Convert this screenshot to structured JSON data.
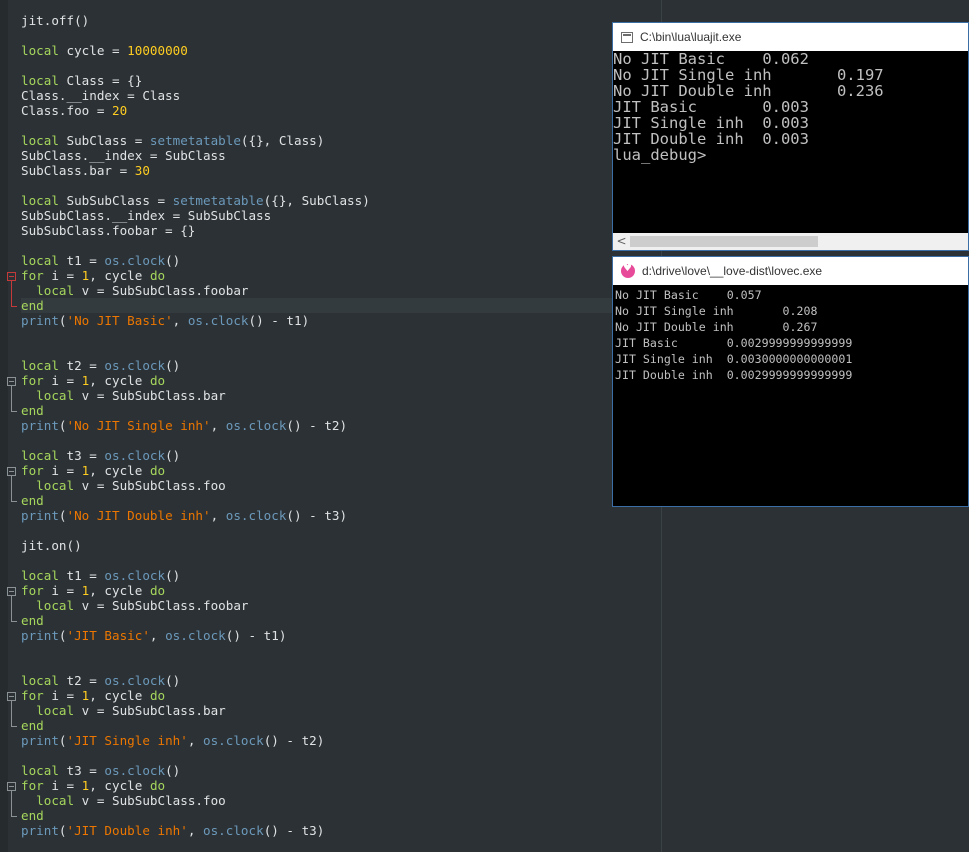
{
  "editor": {
    "lines": [
      [
        [
          "t",
          "jit.off()"
        ]
      ],
      [],
      [
        [
          "kw",
          "local"
        ],
        [
          "t",
          " cycle = "
        ],
        [
          "num",
          "10000000"
        ]
      ],
      [],
      [
        [
          "kw",
          "local"
        ],
        [
          "t",
          " Class = {}"
        ]
      ],
      [
        [
          "t",
          "Class.__index = Class"
        ]
      ],
      [
        [
          "t",
          "Class.foo = "
        ],
        [
          "num",
          "20"
        ]
      ],
      [],
      [
        [
          "kw",
          "local"
        ],
        [
          "t",
          " SubClass = "
        ],
        [
          "fn",
          "setmetatable"
        ],
        [
          "t",
          "({}, Class)"
        ]
      ],
      [
        [
          "t",
          "SubClass.__index = SubClass"
        ]
      ],
      [
        [
          "t",
          "SubClass.bar = "
        ],
        [
          "num",
          "30"
        ]
      ],
      [],
      [
        [
          "kw",
          "local"
        ],
        [
          "t",
          " SubSubClass = "
        ],
        [
          "fn",
          "setmetatable"
        ],
        [
          "t",
          "({}, SubClass)"
        ]
      ],
      [
        [
          "t",
          "SubSubClass.__index = SubSubClass"
        ]
      ],
      [
        [
          "t",
          "SubSubClass.foobar = {}"
        ]
      ],
      [],
      [
        [
          "kw",
          "local"
        ],
        [
          "t",
          " t1 = "
        ],
        [
          "fn",
          "os.clock"
        ],
        [
          "t",
          "()"
        ]
      ],
      [
        [
          "kw",
          "for"
        ],
        [
          "t",
          " i = "
        ],
        [
          "num",
          "1"
        ],
        [
          "t",
          ", cycle "
        ],
        [
          "kw",
          "do"
        ]
      ],
      [
        [
          "t",
          "  "
        ],
        [
          "kw",
          "local"
        ],
        [
          "t",
          " v = SubSubClass.foobar"
        ]
      ],
      [
        [
          "kw",
          "end"
        ]
      ],
      [
        [
          "fn",
          "print"
        ],
        [
          "t",
          "("
        ],
        [
          "str",
          "'No JIT Basic'"
        ],
        [
          "t",
          ", "
        ],
        [
          "fn",
          "os.clock"
        ],
        [
          "t",
          "() - t1)"
        ]
      ],
      [],
      [],
      [
        [
          "kw",
          "local"
        ],
        [
          "t",
          " t2 = "
        ],
        [
          "fn",
          "os.clock"
        ],
        [
          "t",
          "()"
        ]
      ],
      [
        [
          "kw",
          "for"
        ],
        [
          "t",
          " i = "
        ],
        [
          "num",
          "1"
        ],
        [
          "t",
          ", cycle "
        ],
        [
          "kw",
          "do"
        ]
      ],
      [
        [
          "t",
          "  "
        ],
        [
          "kw",
          "local"
        ],
        [
          "t",
          " v = SubSubClass.bar"
        ]
      ],
      [
        [
          "kw",
          "end"
        ]
      ],
      [
        [
          "fn",
          "print"
        ],
        [
          "t",
          "("
        ],
        [
          "str",
          "'No JIT Single inh'"
        ],
        [
          "t",
          ", "
        ],
        [
          "fn",
          "os.clock"
        ],
        [
          "t",
          "() - t2)"
        ]
      ],
      [],
      [
        [
          "kw",
          "local"
        ],
        [
          "t",
          " t3 = "
        ],
        [
          "fn",
          "os.clock"
        ],
        [
          "t",
          "()"
        ]
      ],
      [
        [
          "kw",
          "for"
        ],
        [
          "t",
          " i = "
        ],
        [
          "num",
          "1"
        ],
        [
          "t",
          ", cycle "
        ],
        [
          "kw",
          "do"
        ]
      ],
      [
        [
          "t",
          "  "
        ],
        [
          "kw",
          "local"
        ],
        [
          "t",
          " v = SubSubClass.foo"
        ]
      ],
      [
        [
          "kw",
          "end"
        ]
      ],
      [
        [
          "fn",
          "print"
        ],
        [
          "t",
          "("
        ],
        [
          "str",
          "'No JIT Double inh'"
        ],
        [
          "t",
          ", "
        ],
        [
          "fn",
          "os.clock"
        ],
        [
          "t",
          "() - t3)"
        ]
      ],
      [],
      [
        [
          "t",
          "jit.on()"
        ]
      ],
      [],
      [
        [
          "kw",
          "local"
        ],
        [
          "t",
          " t1 = "
        ],
        [
          "fn",
          "os.clock"
        ],
        [
          "t",
          "()"
        ]
      ],
      [
        [
          "kw",
          "for"
        ],
        [
          "t",
          " i = "
        ],
        [
          "num",
          "1"
        ],
        [
          "t",
          ", cycle "
        ],
        [
          "kw",
          "do"
        ]
      ],
      [
        [
          "t",
          "  "
        ],
        [
          "kw",
          "local"
        ],
        [
          "t",
          " v = SubSubClass.foobar"
        ]
      ],
      [
        [
          "kw",
          "end"
        ]
      ],
      [
        [
          "fn",
          "print"
        ],
        [
          "t",
          "("
        ],
        [
          "str",
          "'JIT Basic'"
        ],
        [
          "t",
          ", "
        ],
        [
          "fn",
          "os.clock"
        ],
        [
          "t",
          "() - t1)"
        ]
      ],
      [],
      [],
      [
        [
          "kw",
          "local"
        ],
        [
          "t",
          " t2 = "
        ],
        [
          "fn",
          "os.clock"
        ],
        [
          "t",
          "()"
        ]
      ],
      [
        [
          "kw",
          "for"
        ],
        [
          "t",
          " i = "
        ],
        [
          "num",
          "1"
        ],
        [
          "t",
          ", cycle "
        ],
        [
          "kw",
          "do"
        ]
      ],
      [
        [
          "t",
          "  "
        ],
        [
          "kw",
          "local"
        ],
        [
          "t",
          " v = SubSubClass.bar"
        ]
      ],
      [
        [
          "kw",
          "end"
        ]
      ],
      [
        [
          "fn",
          "print"
        ],
        [
          "t",
          "("
        ],
        [
          "str",
          "'JIT Single inh'"
        ],
        [
          "t",
          ", "
        ],
        [
          "fn",
          "os.clock"
        ],
        [
          "t",
          "() - t2)"
        ]
      ],
      [],
      [
        [
          "kw",
          "local"
        ],
        [
          "t",
          " t3 = "
        ],
        [
          "fn",
          "os.clock"
        ],
        [
          "t",
          "()"
        ]
      ],
      [
        [
          "kw",
          "for"
        ],
        [
          "t",
          " i = "
        ],
        [
          "num",
          "1"
        ],
        [
          "t",
          ", cycle "
        ],
        [
          "kw",
          "do"
        ]
      ],
      [
        [
          "t",
          "  "
        ],
        [
          "kw",
          "local"
        ],
        [
          "t",
          " v = SubSubClass.foo"
        ]
      ],
      [
        [
          "kw",
          "end"
        ]
      ],
      [
        [
          "fn",
          "print"
        ],
        [
          "t",
          "("
        ],
        [
          "str",
          "'JIT Double inh'"
        ],
        [
          "t",
          ", "
        ],
        [
          "fn",
          "os.clock"
        ],
        [
          "t",
          "() - t3)"
        ]
      ]
    ]
  },
  "luajit_window": {
    "title": "C:\\bin\\lua\\luajit.exe",
    "output": [
      "No JIT Basic\t0.062",
      "No JIT Single inh\t0.197",
      "No JIT Double inh\t0.236",
      "JIT Basic\t0.003",
      "JIT Single inh\t0.003",
      "JIT Double inh\t0.003",
      "lua_debug>"
    ],
    "scroll_left_glyph": "<"
  },
  "love_window": {
    "title": "d:\\drive\\love\\__love-dist\\lovec.exe",
    "output": [
      "No JIT Basic\t0.057",
      "No JIT Single inh\t0.208",
      "No JIT Double inh\t0.267",
      "JIT Basic\t0.0029999999999999",
      "JIT Single inh\t0.0030000000000001",
      "JIT Double inh\t0.0029999999999999"
    ]
  }
}
